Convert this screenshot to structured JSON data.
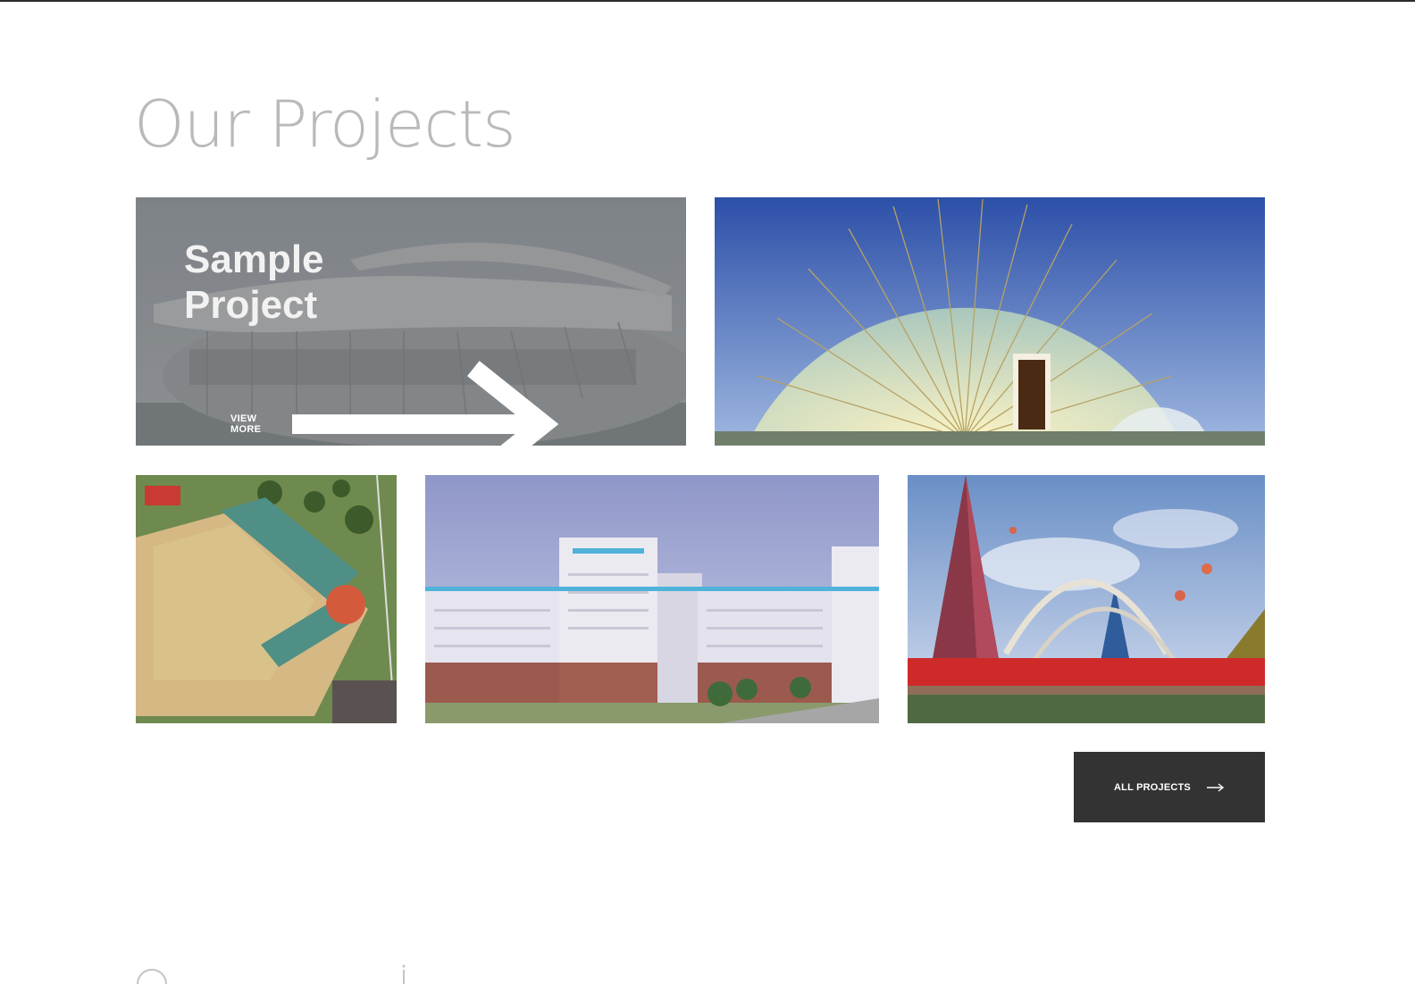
{
  "section": {
    "title": "Our Projects"
  },
  "projects": [
    {
      "caption": "Sample Project",
      "link_label": "VIEW MORE",
      "icon": "arrow-right-icon",
      "image": "stadium-building"
    },
    {
      "image": "glass-dome-building"
    },
    {
      "image": "aerial-sports-complex"
    },
    {
      "image": "residential-towers"
    },
    {
      "image": "pyramid-arch-gateway"
    }
  ],
  "cta": {
    "label": "ALL PROJECTS",
    "icon": "arrow-right-icon"
  },
  "colors": {
    "title": "#b9b9b9",
    "button_bg": "#333333",
    "top_rule": "#2b2b2b"
  }
}
